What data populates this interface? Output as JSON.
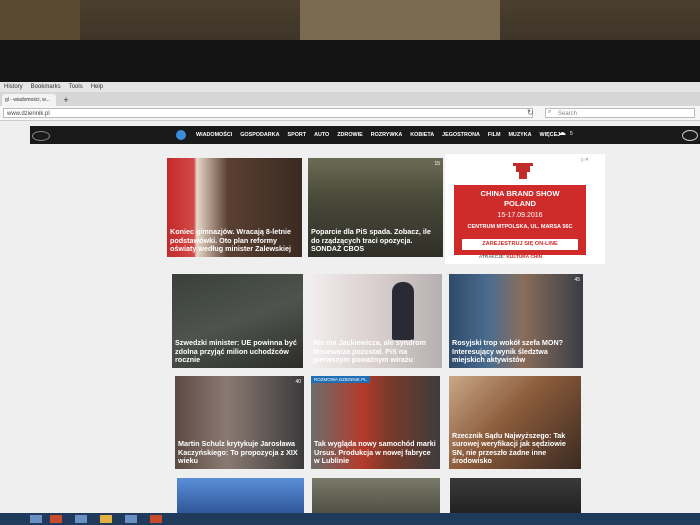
{
  "browser": {
    "menu": [
      "History",
      "Bookmarks",
      "Tools",
      "Help"
    ],
    "tab_title": "gl - wiadomości, w...",
    "new_tab": "+",
    "url": "www.dziennik.pl",
    "search_placeholder": "Search"
  },
  "nav": {
    "items": [
      "WIADOMOŚCI",
      "GOSPODARKA",
      "SPORT",
      "AUTO",
      "ZDROWIE",
      "ROZRYWKA",
      "KOBIETA",
      "JEGOSTRONA",
      "FILM",
      "MUZYKA",
      "WIĘCEJ"
    ],
    "weather_temp": "5",
    "weather_icon": "cloud-sun-icon"
  },
  "articles": [
    {
      "id": "a1",
      "text": "Koniec gimnazjów. Wracają 8-letnie podstawówki. Oto plan reformy oświaty według minister Zalewskiej",
      "badge": ""
    },
    {
      "id": "a2",
      "text": "Poparcie dla PiS spada. Zobacz, ile do rządzących traci opozycja. SONDAŻ CBOS",
      "badge": "15"
    },
    {
      "id": "a3",
      "text": "Szwedzki minister: UE powinna być zdolna przyjąć milion uchodźców rocznie",
      "badge": ""
    },
    {
      "id": "a4",
      "text": "Nie ma Jackiewicza, ale syndrom Misiewicza pozostał. PiS na pierwszym poważnym wirażu",
      "badge": ""
    },
    {
      "id": "a5",
      "text": "Rosyjski trop wokół szefa MON? Interesujący wynik śledztwa miejskich aktywistów",
      "badge": "45"
    },
    {
      "id": "a6",
      "text": "Martin Schulz krytykuje Jarosława Kaczyńskiego: To propozycja z XIX wieku",
      "badge": "40"
    },
    {
      "id": "a7",
      "text": "Tak wygląda nowy samochód marki Ursus. Produkcja w nowej fabryce w Lublinie",
      "badge": "",
      "tag": "ROZMOWA DZIENNIK.PL"
    },
    {
      "id": "a8",
      "text": "Rzecznik Sądu Najwyższego: Tak surowej weryfikacji jak sędziowie SN, nie przeszło żadne inne środowisko",
      "badge": ""
    }
  ],
  "ad": {
    "title_line1": "CHINA BRAND SHOW",
    "title_line2": "POLAND",
    "date": "15-17.09.2016",
    "venue": "CENTRUM MTPOLSKA, UL. MARSA 56C",
    "cta": "ZAREJESTRUJ SIĘ ON-LINE",
    "attraction_label": "ATRAKCJE:",
    "attraction_value": "KULTURA CHIN"
  }
}
